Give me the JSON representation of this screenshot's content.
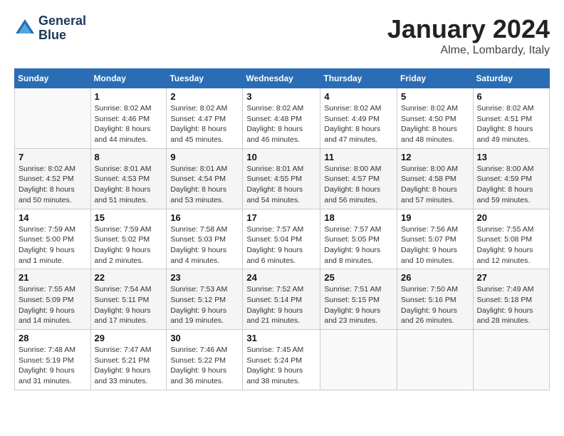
{
  "logo": {
    "line1": "General",
    "line2": "Blue"
  },
  "title": "January 2024",
  "subtitle": "Alme, Lombardy, Italy",
  "days_header": [
    "Sunday",
    "Monday",
    "Tuesday",
    "Wednesday",
    "Thursday",
    "Friday",
    "Saturday"
  ],
  "weeks": [
    [
      {
        "num": "",
        "info": ""
      },
      {
        "num": "1",
        "info": "Sunrise: 8:02 AM\nSunset: 4:46 PM\nDaylight: 8 hours\nand 44 minutes."
      },
      {
        "num": "2",
        "info": "Sunrise: 8:02 AM\nSunset: 4:47 PM\nDaylight: 8 hours\nand 45 minutes."
      },
      {
        "num": "3",
        "info": "Sunrise: 8:02 AM\nSunset: 4:48 PM\nDaylight: 8 hours\nand 46 minutes."
      },
      {
        "num": "4",
        "info": "Sunrise: 8:02 AM\nSunset: 4:49 PM\nDaylight: 8 hours\nand 47 minutes."
      },
      {
        "num": "5",
        "info": "Sunrise: 8:02 AM\nSunset: 4:50 PM\nDaylight: 8 hours\nand 48 minutes."
      },
      {
        "num": "6",
        "info": "Sunrise: 8:02 AM\nSunset: 4:51 PM\nDaylight: 8 hours\nand 49 minutes."
      }
    ],
    [
      {
        "num": "7",
        "info": "Sunrise: 8:02 AM\nSunset: 4:52 PM\nDaylight: 8 hours\nand 50 minutes."
      },
      {
        "num": "8",
        "info": "Sunrise: 8:01 AM\nSunset: 4:53 PM\nDaylight: 8 hours\nand 51 minutes."
      },
      {
        "num": "9",
        "info": "Sunrise: 8:01 AM\nSunset: 4:54 PM\nDaylight: 8 hours\nand 53 minutes."
      },
      {
        "num": "10",
        "info": "Sunrise: 8:01 AM\nSunset: 4:55 PM\nDaylight: 8 hours\nand 54 minutes."
      },
      {
        "num": "11",
        "info": "Sunrise: 8:00 AM\nSunset: 4:57 PM\nDaylight: 8 hours\nand 56 minutes."
      },
      {
        "num": "12",
        "info": "Sunrise: 8:00 AM\nSunset: 4:58 PM\nDaylight: 8 hours\nand 57 minutes."
      },
      {
        "num": "13",
        "info": "Sunrise: 8:00 AM\nSunset: 4:59 PM\nDaylight: 8 hours\nand 59 minutes."
      }
    ],
    [
      {
        "num": "14",
        "info": "Sunrise: 7:59 AM\nSunset: 5:00 PM\nDaylight: 9 hours\nand 1 minute."
      },
      {
        "num": "15",
        "info": "Sunrise: 7:59 AM\nSunset: 5:02 PM\nDaylight: 9 hours\nand 2 minutes."
      },
      {
        "num": "16",
        "info": "Sunrise: 7:58 AM\nSunset: 5:03 PM\nDaylight: 9 hours\nand 4 minutes."
      },
      {
        "num": "17",
        "info": "Sunrise: 7:57 AM\nSunset: 5:04 PM\nDaylight: 9 hours\nand 6 minutes."
      },
      {
        "num": "18",
        "info": "Sunrise: 7:57 AM\nSunset: 5:05 PM\nDaylight: 9 hours\nand 8 minutes."
      },
      {
        "num": "19",
        "info": "Sunrise: 7:56 AM\nSunset: 5:07 PM\nDaylight: 9 hours\nand 10 minutes."
      },
      {
        "num": "20",
        "info": "Sunrise: 7:55 AM\nSunset: 5:08 PM\nDaylight: 9 hours\nand 12 minutes."
      }
    ],
    [
      {
        "num": "21",
        "info": "Sunrise: 7:55 AM\nSunset: 5:09 PM\nDaylight: 9 hours\nand 14 minutes."
      },
      {
        "num": "22",
        "info": "Sunrise: 7:54 AM\nSunset: 5:11 PM\nDaylight: 9 hours\nand 17 minutes."
      },
      {
        "num": "23",
        "info": "Sunrise: 7:53 AM\nSunset: 5:12 PM\nDaylight: 9 hours\nand 19 minutes."
      },
      {
        "num": "24",
        "info": "Sunrise: 7:52 AM\nSunset: 5:14 PM\nDaylight: 9 hours\nand 21 minutes."
      },
      {
        "num": "25",
        "info": "Sunrise: 7:51 AM\nSunset: 5:15 PM\nDaylight: 9 hours\nand 23 minutes."
      },
      {
        "num": "26",
        "info": "Sunrise: 7:50 AM\nSunset: 5:16 PM\nDaylight: 9 hours\nand 26 minutes."
      },
      {
        "num": "27",
        "info": "Sunrise: 7:49 AM\nSunset: 5:18 PM\nDaylight: 9 hours\nand 28 minutes."
      }
    ],
    [
      {
        "num": "28",
        "info": "Sunrise: 7:48 AM\nSunset: 5:19 PM\nDaylight: 9 hours\nand 31 minutes."
      },
      {
        "num": "29",
        "info": "Sunrise: 7:47 AM\nSunset: 5:21 PM\nDaylight: 9 hours\nand 33 minutes."
      },
      {
        "num": "30",
        "info": "Sunrise: 7:46 AM\nSunset: 5:22 PM\nDaylight: 9 hours\nand 36 minutes."
      },
      {
        "num": "31",
        "info": "Sunrise: 7:45 AM\nSunset: 5:24 PM\nDaylight: 9 hours\nand 38 minutes."
      },
      {
        "num": "",
        "info": ""
      },
      {
        "num": "",
        "info": ""
      },
      {
        "num": "",
        "info": ""
      }
    ]
  ]
}
